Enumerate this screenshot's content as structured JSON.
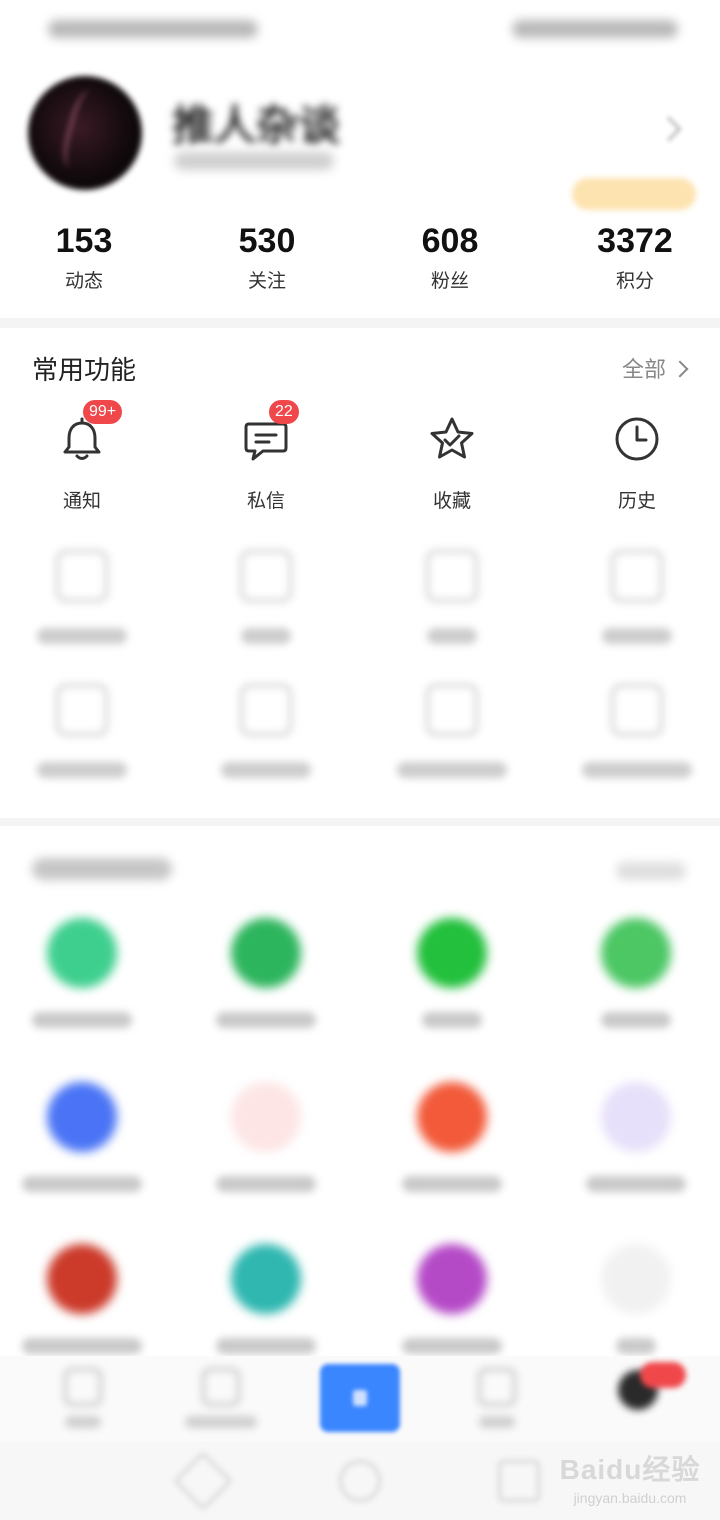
{
  "profile": {
    "username": "推人杂谈",
    "stats": [
      {
        "value": "153",
        "label": "动态"
      },
      {
        "value": "530",
        "label": "关注"
      },
      {
        "value": "608",
        "label": "粉丝"
      },
      {
        "value": "3372",
        "label": "积分"
      }
    ]
  },
  "functions": {
    "title": "常用功能",
    "all_label": "全部",
    "items": [
      {
        "label": "通知",
        "icon": "bell-icon",
        "badge": "99+"
      },
      {
        "label": "私信",
        "icon": "message-icon",
        "badge": "22"
      },
      {
        "label": "收藏",
        "icon": "star-icon"
      },
      {
        "label": "历史",
        "icon": "clock-icon"
      }
    ]
  },
  "colors": {
    "badge": "#f0474b",
    "publish_button": "#3a86ff",
    "points_badge": "#fde3b0"
  },
  "watermark": {
    "main": "Baidu经验",
    "sub": "jingyan.baidu.com"
  }
}
